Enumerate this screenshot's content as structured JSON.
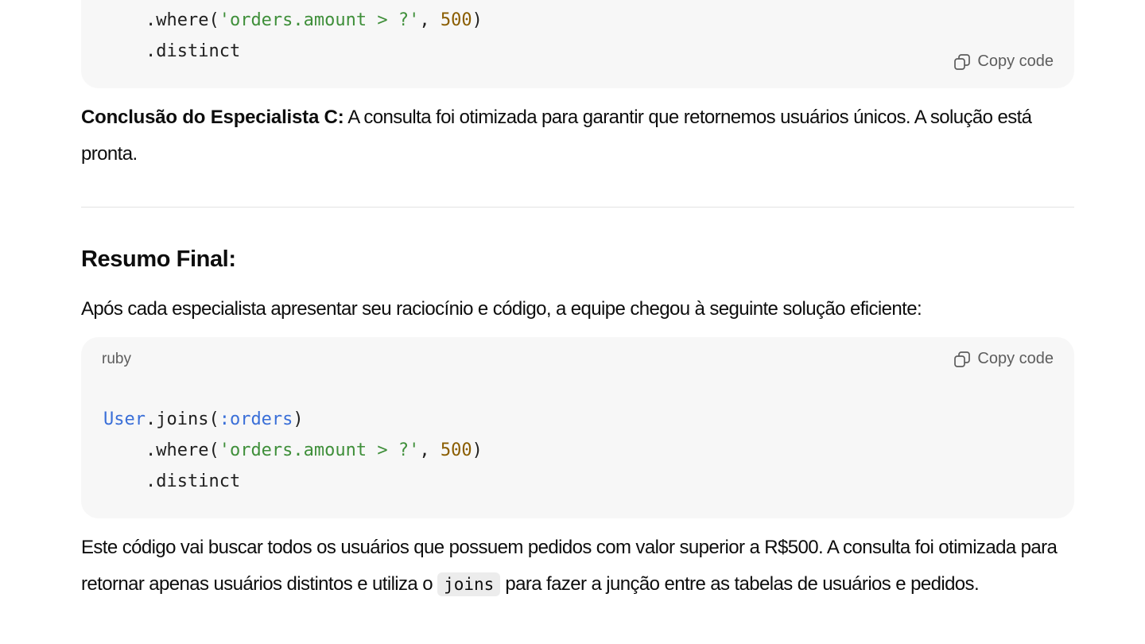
{
  "top_code": {
    "lines": [
      {
        "indent": "    ",
        "method": ".where(",
        "string": "'orders.amount > ?'",
        "sep": ", ",
        "number": "500",
        "close": ")"
      },
      {
        "indent": "    ",
        "method": ".distinct"
      }
    ],
    "copy_label": "Copy code"
  },
  "conclusion": {
    "bold": "Conclusão do Especialista C:",
    "text": " A consulta foi otimizada para garantir que retornemos usuários únicos. A solução está pronta."
  },
  "summary": {
    "heading": "Resumo Final:",
    "intro": "Após cada especialista apresentar seu raciocínio e código, a equipe chegou à seguinte solução eficiente:"
  },
  "bottom_code": {
    "language": "ruby",
    "copy_label": "Copy code",
    "line1": {
      "const": "User",
      "call": ".joins(",
      "symbol": ":orders",
      "close": ")"
    },
    "line2": {
      "indent": "    ",
      "method": ".where(",
      "string": "'orders.amount > ?'",
      "sep": ", ",
      "number": "500",
      "close": ")"
    },
    "line3": {
      "indent": "    ",
      "method": ".distinct"
    }
  },
  "closing": {
    "text_before": "Este código vai buscar todos os usuários que possuem pedidos com valor superior a R$500. A consulta foi otimizada para retornar apenas usuários distintos e utiliza o ",
    "inline_code": "joins",
    "text_after": " para fazer a junção entre as tabelas de usuários e pedidos."
  },
  "icons": {
    "copy": "copy-icon"
  }
}
